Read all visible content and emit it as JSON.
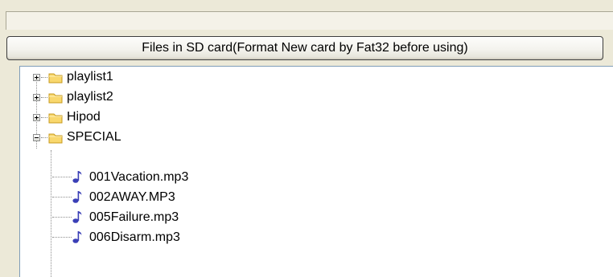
{
  "header": {
    "title": "Files in SD card(Format New card by Fat32 before using)"
  },
  "tree": {
    "folders": [
      {
        "label": "playlist1",
        "expanded": false
      },
      {
        "label": "playlist2",
        "expanded": false
      },
      {
        "label": "Hipod",
        "expanded": false
      },
      {
        "label": "SPECIAL",
        "expanded": true
      }
    ],
    "files": [
      {
        "label": "001Vacation.mp3"
      },
      {
        "label": "002AWAY.MP3"
      },
      {
        "label": "005Failure.mp3"
      },
      {
        "label": "006Disarm.mp3"
      }
    ]
  },
  "icons": {
    "folder": "folder-icon",
    "file": "music-note-icon",
    "collapsed": "plus-expander-icon",
    "expanded": "minus-expander-icon"
  },
  "colors": {
    "folder_fill": "#f9d86e",
    "folder_stroke": "#c79a1c",
    "note": "#3a3fb6",
    "tree_background": "#ffffff",
    "window_background": "#ece9d8"
  }
}
